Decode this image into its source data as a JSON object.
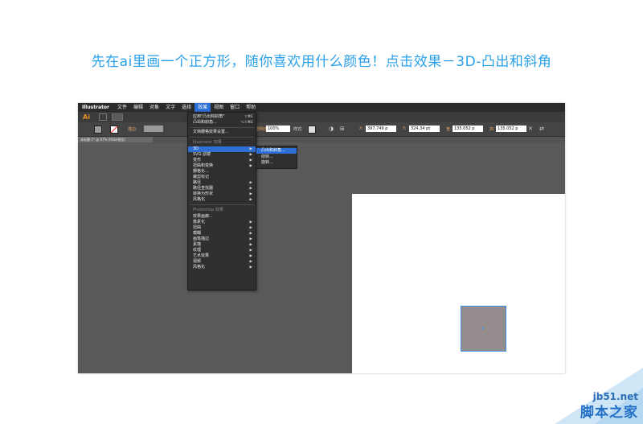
{
  "headline": "先在ai里画一个正方形，随你喜欢用什么颜色！点击效果－3D-凸出和斜角",
  "app": {
    "name": "Illustrator",
    "menus": [
      "文件",
      "编辑",
      "对象",
      "文字",
      "选择",
      "效果",
      "视图",
      "窗口",
      "帮助"
    ],
    "active_menu": "效果",
    "logo": "Ai"
  },
  "controlbar": {
    "stroke_label": "描边:",
    "opacity_label": "不透明度:",
    "opacity_value": "100%",
    "style_label": "样式:",
    "x_label": "X:",
    "x_value": "397.749 p",
    "y_label": "Y:",
    "y_value": "324.34 pt",
    "w_label": "宽:",
    "w_value": "135.052 p",
    "h_label": "高:",
    "h_value": "135.052 p"
  },
  "document_tab": "未标题-1* @ 97% (RGB/预览)",
  "effect_menu": {
    "apply_last": "应用\"凸出和斜角\"",
    "apply_last_shortcut": "⇧⌘E",
    "last_effect": "凸出和斜角...",
    "last_effect_shortcut": "⌥⇧⌘E",
    "doc_raster": "文档栅格效果设置...",
    "illustrator_section": "Illustrator 效果",
    "illustrator_items": [
      "3D",
      "SVG 滤镜",
      "变形",
      "扭曲和变换",
      "栅格化...",
      "裁剪标记",
      "路径",
      "路径查找器",
      "转换为形状",
      "风格化"
    ],
    "photoshop_section": "Photoshop 效果",
    "photoshop_items": [
      "效果画廊...",
      "像素化",
      "扭曲",
      "模糊",
      "画笔描边",
      "素描",
      "纹理",
      "艺术效果",
      "视频",
      "风格化"
    ],
    "arrow": "▶"
  },
  "submenu_3d": [
    "凸出和斜角...",
    "绕转...",
    "旋转..."
  ],
  "square_color": "#958d8d",
  "selection_color": "#3b8df0",
  "watermark": {
    "domain": "jb51.net",
    "name": "脚本之家"
  }
}
